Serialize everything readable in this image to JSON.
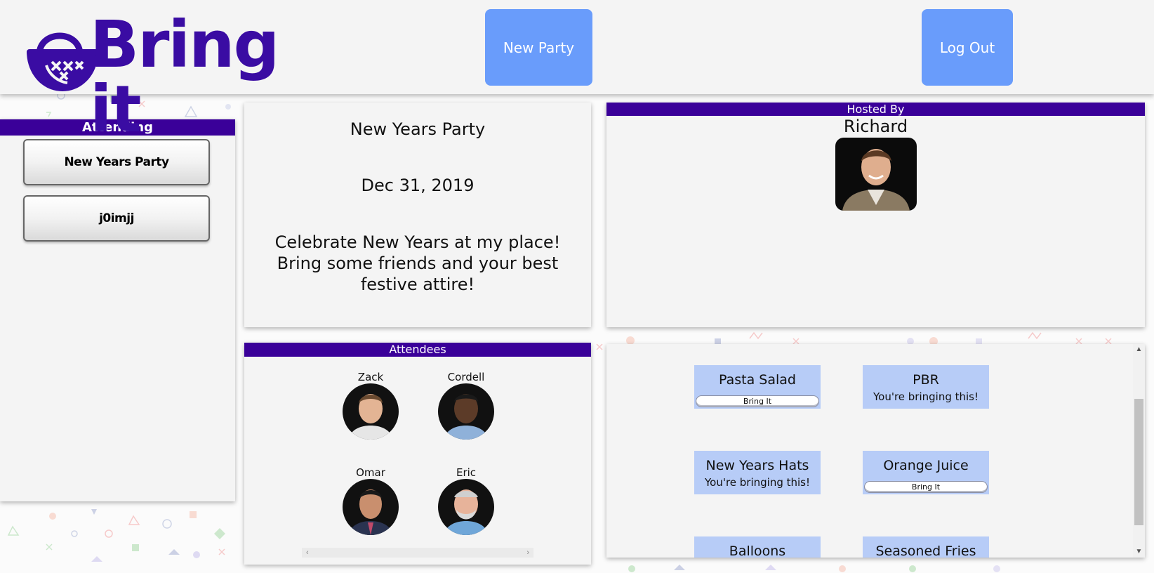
{
  "app": {
    "logo_text": "Bring it"
  },
  "header": {
    "new_party_label": "New Party",
    "logout_label": "Log Out"
  },
  "attending": {
    "title": "Attending",
    "items": [
      {
        "label": "New Years Party"
      },
      {
        "label": "j0imjj"
      }
    ]
  },
  "party": {
    "title": "New Years Party",
    "date": "Dec 31, 2019",
    "description": "Celebrate New Years at my place! Bring some friends and your best festive attire!"
  },
  "host": {
    "title": "Hosted By",
    "name": "Richard"
  },
  "attendees": {
    "title": "Attendees",
    "people": [
      {
        "name": "Zack"
      },
      {
        "name": "Cordell"
      },
      {
        "name": "Omar"
      },
      {
        "name": "Eric"
      }
    ]
  },
  "items": {
    "bring_label": "Bring It",
    "bringing_label": "You're bringing this!",
    "list": [
      {
        "name": "Pasta Salad",
        "status": "bring"
      },
      {
        "name": "PBR",
        "status": "bringing"
      },
      {
        "name": "New Years Hats",
        "status": "bringing"
      },
      {
        "name": "Orange Juice",
        "status": "bring"
      },
      {
        "name": "Balloons",
        "status": ""
      },
      {
        "name": "Seasoned Fries",
        "status": ""
      }
    ]
  },
  "colors": {
    "brand": "#3a0ca3",
    "accent": "#699cfb",
    "bar": "#3a0099",
    "card": "#b7ccf7"
  }
}
